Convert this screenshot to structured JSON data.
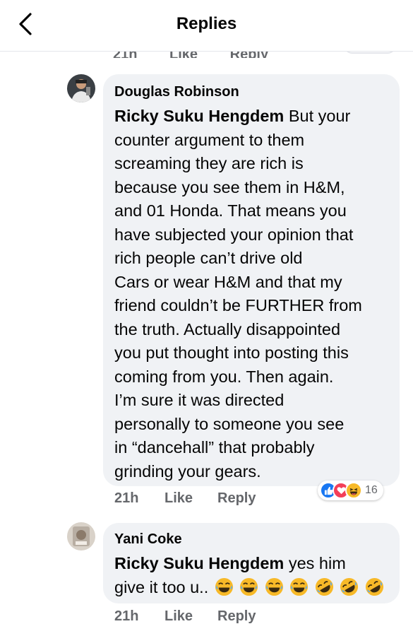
{
  "header": {
    "title": "Replies",
    "back_icon": "chevron-left-icon"
  },
  "prev_comment_actions": {
    "time": "21h",
    "like": "Like",
    "reply": "Reply"
  },
  "comments": [
    {
      "author": "Douglas Robinson",
      "mention": "Ricky Suku Hengdem",
      "lines": [
        " But your",
        "counter argument to them",
        "screaming they are rich is",
        "because you see them in H&M,",
        "and 01 Honda. That means you",
        "have subjected your opinion that",
        "rich people can’t drive old",
        "Cars or wear H&M and that my",
        "friend couldn’t be FURTHER from",
        "the truth. Actually disappointed",
        "you put thought into posting this",
        "coming from you. Then again.",
        "I’m sure it was directed",
        "personally to someone you see",
        "in “dancehall” that probably",
        "grinding your gears."
      ],
      "time": "21h",
      "like": "Like",
      "reply": "Reply",
      "reactions": {
        "icons": [
          "like-icon",
          "love-icon",
          "haha-icon"
        ],
        "count": "16"
      }
    },
    {
      "author": "Yani Coke",
      "mention": "Ricky Suku Hengdem",
      "line1": " yes him",
      "line2": "give it too u..",
      "emojis": [
        "joy-emoji",
        "joy-emoji",
        "joy-emoji",
        "joy-emoji",
        "rofl-emoji",
        "rofl-emoji",
        "rofl-emoji"
      ],
      "time": "21h",
      "like": "Like",
      "reply": "Reply"
    }
  ],
  "colors": {
    "bubble": "#f0f2f5",
    "like_blue": "#1877f2",
    "love_red": "#f33e58",
    "haha_yellow": "#f7b928",
    "meta_gray": "#65676b"
  }
}
